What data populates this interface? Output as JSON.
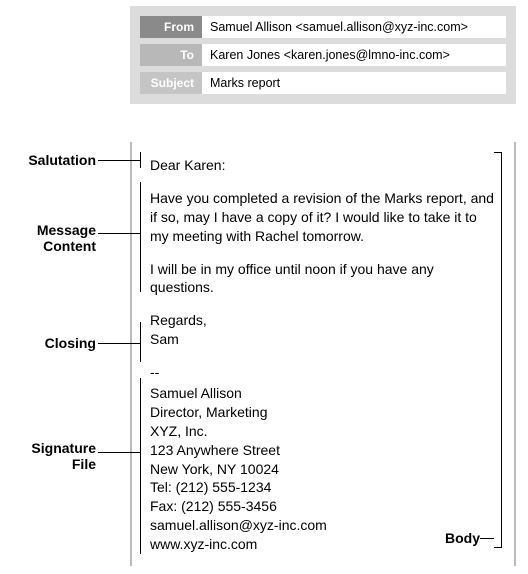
{
  "header": {
    "from_label": "From",
    "from_value": "Samuel Allison <samuel.allison@xyz-inc.com>",
    "to_label": "To",
    "to_value": "Karen Jones <karen.jones@lmno-inc.com>",
    "subject_label": "Subject",
    "subject_value": "Marks report"
  },
  "annotations": {
    "salutation": "Salutation",
    "message": "Message Content",
    "closing": "Closing",
    "signature": "Signature File",
    "body": "Body"
  },
  "email": {
    "salutation": "Dear Karen:",
    "para1": "Have you completed a revision of the Marks report, and if so, may I have a copy of it? I would like to take it to my meeting with Rachel tomorrow.",
    "para2": "I will be in my office until noon if you have any questions.",
    "closing_word": "Regards,",
    "closing_name": "Sam",
    "sig_sep": "--",
    "sig": {
      "name": "Samuel Allison",
      "title": "Director, Marketing",
      "company": "XYZ, Inc.",
      "street": "123 Anywhere Street",
      "city": "New York, NY 10024",
      "tel": "Tel: (212) 555-1234",
      "fax": "Fax: (212) 555-3456",
      "email": "samuel.allison@xyz-inc.com",
      "url": "www.xyz-inc.com"
    }
  }
}
